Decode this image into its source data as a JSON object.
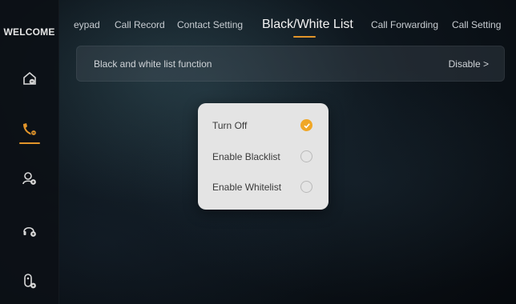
{
  "sidebar": {
    "title": "WELCOME",
    "items": [
      {
        "icon": "home-phone-icon"
      },
      {
        "icon": "phone-call-icon",
        "active": true
      },
      {
        "icon": "user-settings-icon"
      },
      {
        "icon": "headset-settings-icon"
      },
      {
        "icon": "intercom-settings-icon"
      }
    ]
  },
  "tabs": [
    {
      "label": "eypad"
    },
    {
      "label": "Call Record"
    },
    {
      "label": "Contact Setting"
    },
    {
      "label": "Black/White List",
      "active": true
    },
    {
      "label": "Call Forwarding"
    },
    {
      "label": "Call Setting"
    }
  ],
  "banner": {
    "label": "Black and white list function",
    "value": "Disable >"
  },
  "popup": {
    "options": [
      {
        "label": "Turn Off",
        "selected": true
      },
      {
        "label": "Enable Blacklist",
        "selected": false
      },
      {
        "label": "Enable Whitelist",
        "selected": false
      }
    ]
  },
  "colors": {
    "accent": "#e2952a",
    "popup_bg": "#e4e4e4"
  }
}
